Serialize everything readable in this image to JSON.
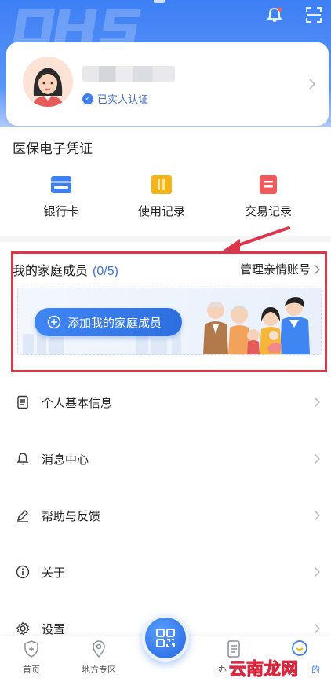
{
  "profile": {
    "verified_label": "已实人认证"
  },
  "credential": {
    "title": "医保电子凭证",
    "actions": [
      {
        "label": "银行卡",
        "icon": "bank-card-icon",
        "color": "#3d7ff5"
      },
      {
        "label": "使用记录",
        "icon": "usage-record-icon",
        "color": "#f5b316"
      },
      {
        "label": "交易记录",
        "icon": "transaction-record-icon",
        "color": "#f05a5a"
      }
    ]
  },
  "family": {
    "title": "我的家庭成员",
    "count": "(0/5)",
    "manage_label": "管理亲情账号",
    "add_label": "添加我的家庭成员"
  },
  "menu": [
    {
      "label": "个人基本信息",
      "icon": "document-icon"
    },
    {
      "label": "消息中心",
      "icon": "bell-icon"
    },
    {
      "label": "帮助与反馈",
      "icon": "pen-icon"
    },
    {
      "label": "关于",
      "icon": "info-icon"
    },
    {
      "label": "设置",
      "icon": "gear-icon"
    }
  ],
  "tabbar": {
    "items": [
      {
        "label": "首页",
        "icon": "shield-icon"
      },
      {
        "label": "地方专区",
        "icon": "location-icon"
      },
      {
        "label": "办",
        "icon": "file-icon"
      },
      {
        "label": "的",
        "icon": "mine-icon"
      }
    ]
  },
  "watermark": "云南龙网",
  "colors": {
    "accent": "#3d7ff5",
    "annotation": "#e0344a"
  }
}
